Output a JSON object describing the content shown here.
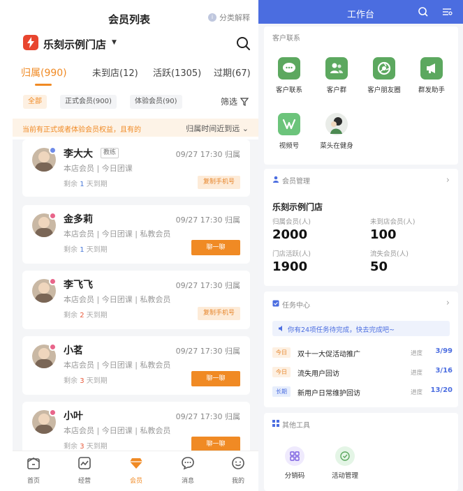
{
  "left": {
    "title": "会员列表",
    "help_label": "分类解释",
    "store_name": "乐刻示例门店",
    "tabs": [
      {
        "label": "归属(990)",
        "active": true
      },
      {
        "label": "未到店(12)",
        "active": false
      },
      {
        "label": "活跃(1305)",
        "active": false
      },
      {
        "label": "过期(67)",
        "active": false
      }
    ],
    "filters": [
      "全部",
      "正式会员(900)",
      "体验会员(90)"
    ],
    "filter_button": "筛选",
    "notice": "当前有正式或者体验会员权益，且有的",
    "sort_label": "归属时间近到远",
    "members": [
      {
        "name": "李大大",
        "badge": "教练",
        "time": "09/27 17:30 归属",
        "tags": "本店会员 | 今日团课",
        "expire_prefix": "剩余",
        "expire_days": "1",
        "expire_suffix": "天到期",
        "action": "复制手机号",
        "action_type": "copy",
        "badge_color": "#6e8be8",
        "days_color": "blue"
      },
      {
        "name": "金多莉",
        "badge": "",
        "time": "09/27 17:30 归属",
        "tags": "本店会员 | 今日团课 | 私教会员",
        "expire_prefix": "剩余",
        "expire_days": "1",
        "expire_suffix": "天到期",
        "action": "聊一聊",
        "action_type": "contact",
        "badge_color": "#e8658a",
        "days_color": "blue"
      },
      {
        "name": "李飞飞",
        "badge": "",
        "time": "09/27 17:30 归属",
        "tags": "本店会员 | 今日团课 | 私教会员",
        "expire_prefix": "剩余",
        "expire_days": "2",
        "expire_suffix": "天到期",
        "action": "复制手机号",
        "action_type": "copy",
        "badge_color": "#e8658a",
        "days_color": "red"
      },
      {
        "name": "小茗",
        "badge": "",
        "time": "09/27 17:30 归属",
        "tags": "本店会员 | 今日团课 | 私教会员",
        "expire_prefix": "剩余",
        "expire_days": "3",
        "expire_suffix": "天到期",
        "action": "聊一聊",
        "action_type": "contact",
        "badge_color": "#e8658a",
        "days_color": "red"
      },
      {
        "name": "小叶",
        "badge": "",
        "time": "09/27 17:30 归属",
        "tags": "本店会员 | 今日团课 | 私教会员",
        "expire_prefix": "剩余",
        "expire_days": "3",
        "expire_suffix": "天到期",
        "action": "聊一聊",
        "action_type": "contact",
        "badge_color": "#e8658a",
        "days_color": "red"
      }
    ],
    "nav": [
      {
        "label": "首页",
        "icon": "home-icon",
        "active": false
      },
      {
        "label": "经营",
        "icon": "chart-icon",
        "active": false
      },
      {
        "label": "会员",
        "icon": "diamond-icon",
        "active": true
      },
      {
        "label": "消息",
        "icon": "message-icon",
        "active": false
      },
      {
        "label": "我的",
        "icon": "profile-icon",
        "active": false
      }
    ]
  },
  "right": {
    "title": "工作台",
    "customer_section": "客户联系",
    "apps": [
      {
        "label": "客户联系",
        "icon": "chat-bubble-icon"
      },
      {
        "label": "客户群",
        "icon": "group-icon"
      },
      {
        "label": "客户朋友圈",
        "icon": "aperture-icon"
      },
      {
        "label": "群发助手",
        "icon": "megaphone-icon"
      },
      {
        "label": "视频号",
        "icon": "video-channel-icon"
      },
      {
        "label": "菜头在健身",
        "icon": "mini-program-avatar-icon"
      }
    ],
    "member_section": "会员管理",
    "member_store": "乐刻示例门店",
    "stats": [
      {
        "label": "归属会员(人)",
        "value": "2000"
      },
      {
        "label": "未到店会员(人)",
        "value": "100"
      },
      {
        "label": "门店活跃(人)",
        "value": "1900"
      },
      {
        "label": "流失会员(人)",
        "value": "50"
      }
    ],
    "task_section": "任务中心",
    "task_banner": "你有24项任务待完成，快去完成吧~",
    "tasks": [
      {
        "tag": "今日",
        "tag_type": "today",
        "name": "双十一大促活动推广",
        "progress_label": "进度",
        "progress": "3/99"
      },
      {
        "tag": "今日",
        "tag_type": "today",
        "name": "流失用户回访",
        "progress_label": "进度",
        "progress": "3/16"
      },
      {
        "tag": "长期",
        "tag_type": "long",
        "name": "新用户日常维护回访",
        "progress_label": "进度",
        "progress": "13/20"
      }
    ],
    "tools_section": "其他工具",
    "tools": [
      {
        "label": "分销码",
        "icon": "grid-code-icon"
      },
      {
        "label": "活动管理",
        "icon": "activity-icon"
      }
    ]
  },
  "colors": {
    "accent_orange": "#f08a24",
    "header_blue": "#4b6de0",
    "app_green": "#5ca85f"
  }
}
